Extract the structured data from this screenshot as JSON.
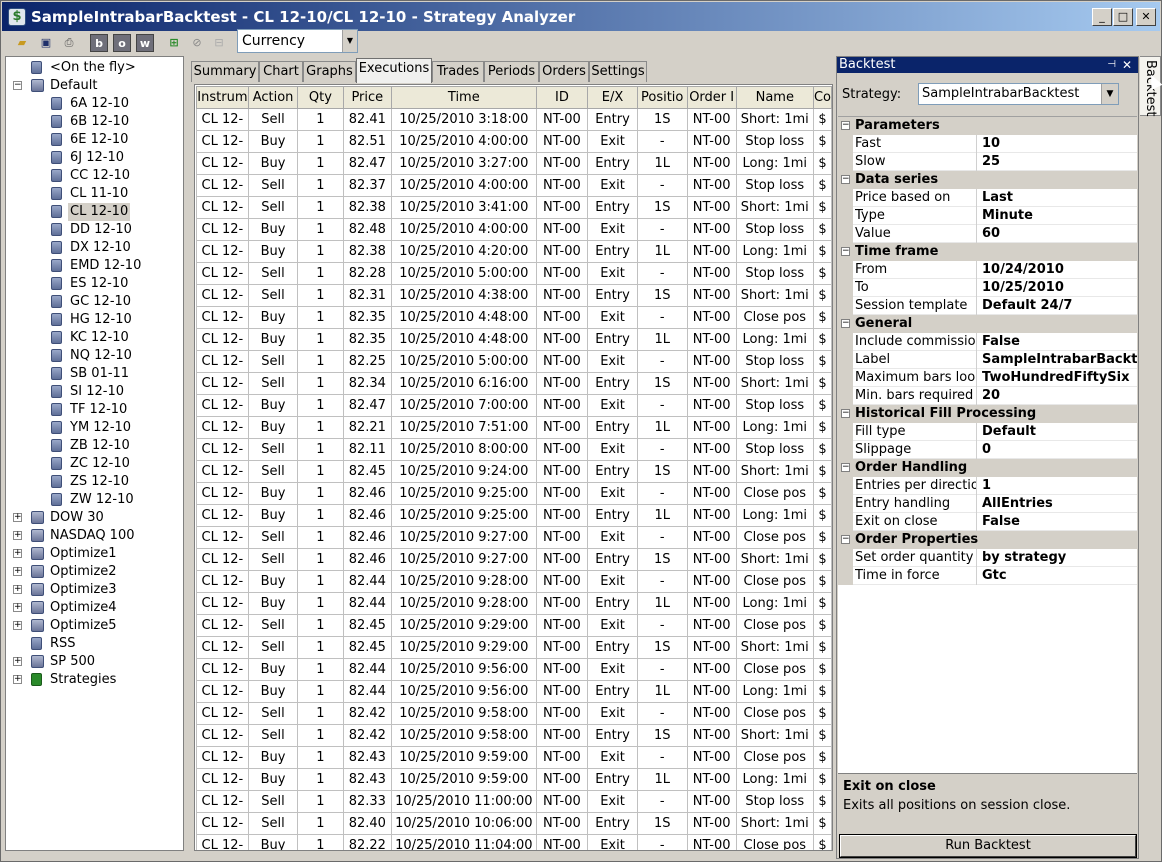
{
  "window": {
    "title": "SampleIntrabarBacktest - CL 12-10/CL 12-10 - Strategy Analyzer",
    "min": "_",
    "max": "□",
    "close": "✕"
  },
  "toolbar": {
    "currency": "Currency"
  },
  "tree": [
    {
      "label": "<On the fly>",
      "type": "item"
    },
    {
      "label": "Default",
      "type": "group",
      "expanded": true
    },
    {
      "label": "6A 12-10",
      "type": "child"
    },
    {
      "label": "6B 12-10",
      "type": "child"
    },
    {
      "label": "6E 12-10",
      "type": "child"
    },
    {
      "label": "6J 12-10",
      "type": "child"
    },
    {
      "label": "CC 12-10",
      "type": "child"
    },
    {
      "label": "CL 11-10",
      "type": "child"
    },
    {
      "label": "CL 12-10",
      "type": "child",
      "selected": true
    },
    {
      "label": "DD 12-10",
      "type": "child"
    },
    {
      "label": "DX 12-10",
      "type": "child"
    },
    {
      "label": "EMD 12-10",
      "type": "child"
    },
    {
      "label": "ES 12-10",
      "type": "child"
    },
    {
      "label": "GC 12-10",
      "type": "child"
    },
    {
      "label": "HG 12-10",
      "type": "child"
    },
    {
      "label": "KC 12-10",
      "type": "child"
    },
    {
      "label": "NQ 12-10",
      "type": "child"
    },
    {
      "label": "SB 01-11",
      "type": "child"
    },
    {
      "label": "SI 12-10",
      "type": "child"
    },
    {
      "label": "TF 12-10",
      "type": "child"
    },
    {
      "label": "YM 12-10",
      "type": "child"
    },
    {
      "label": "ZB 12-10",
      "type": "child"
    },
    {
      "label": "ZC 12-10",
      "type": "child"
    },
    {
      "label": "ZS 12-10",
      "type": "child"
    },
    {
      "label": "ZW 12-10",
      "type": "child"
    },
    {
      "label": "DOW 30",
      "type": "group",
      "expanded": false
    },
    {
      "label": "NASDAQ 100",
      "type": "group",
      "expanded": false
    },
    {
      "label": "Optimize1",
      "type": "group",
      "expanded": false
    },
    {
      "label": "Optimize2",
      "type": "group",
      "expanded": false
    },
    {
      "label": "Optimize3",
      "type": "group",
      "expanded": false
    },
    {
      "label": "Optimize4",
      "type": "group",
      "expanded": false
    },
    {
      "label": "Optimize5",
      "type": "group",
      "expanded": false
    },
    {
      "label": "RSS",
      "type": "item"
    },
    {
      "label": "SP 500",
      "type": "group",
      "expanded": false
    },
    {
      "label": "Strategies",
      "type": "strategies",
      "expanded": false
    }
  ],
  "tabs": [
    "Summary",
    "Chart",
    "Graphs",
    "Executions",
    "Trades",
    "Periods",
    "Orders",
    "Settings"
  ],
  "active_tab": "Executions",
  "table": {
    "columns": [
      "Instrum",
      "Action",
      "Qty",
      "Price",
      "Time",
      "ID",
      "E/X",
      "Positio",
      "Order I",
      "Name",
      "Co"
    ],
    "rows": [
      [
        "CL 12-",
        "Sell",
        "1",
        "82.41",
        "10/25/2010 3:18:00",
        "NT-00",
        "Entry",
        "1S",
        "NT-00",
        "Short: 1mi",
        "$"
      ],
      [
        "CL 12-",
        "Buy",
        "1",
        "82.51",
        "10/25/2010 4:00:00",
        "NT-00",
        "Exit",
        "-",
        "NT-00",
        "Stop loss",
        "$"
      ],
      [
        "CL 12-",
        "Buy",
        "1",
        "82.47",
        "10/25/2010 3:27:00",
        "NT-00",
        "Entry",
        "1L",
        "NT-00",
        "Long: 1mi",
        "$"
      ],
      [
        "CL 12-",
        "Sell",
        "1",
        "82.37",
        "10/25/2010 4:00:00",
        "NT-00",
        "Exit",
        "-",
        "NT-00",
        "Stop loss",
        "$"
      ],
      [
        "CL 12-",
        "Sell",
        "1",
        "82.38",
        "10/25/2010 3:41:00",
        "NT-00",
        "Entry",
        "1S",
        "NT-00",
        "Short: 1mi",
        "$"
      ],
      [
        "CL 12-",
        "Buy",
        "1",
        "82.48",
        "10/25/2010 4:00:00",
        "NT-00",
        "Exit",
        "-",
        "NT-00",
        "Stop loss",
        "$"
      ],
      [
        "CL 12-",
        "Buy",
        "1",
        "82.38",
        "10/25/2010 4:20:00",
        "NT-00",
        "Entry",
        "1L",
        "NT-00",
        "Long: 1mi",
        "$"
      ],
      [
        "CL 12-",
        "Sell",
        "1",
        "82.28",
        "10/25/2010 5:00:00",
        "NT-00",
        "Exit",
        "-",
        "NT-00",
        "Stop loss",
        "$"
      ],
      [
        "CL 12-",
        "Sell",
        "1",
        "82.31",
        "10/25/2010 4:38:00",
        "NT-00",
        "Entry",
        "1S",
        "NT-00",
        "Short: 1mi",
        "$"
      ],
      [
        "CL 12-",
        "Buy",
        "1",
        "82.35",
        "10/25/2010 4:48:00",
        "NT-00",
        "Exit",
        "-",
        "NT-00",
        "Close pos",
        "$"
      ],
      [
        "CL 12-",
        "Buy",
        "1",
        "82.35",
        "10/25/2010 4:48:00",
        "NT-00",
        "Entry",
        "1L",
        "NT-00",
        "Long: 1mi",
        "$"
      ],
      [
        "CL 12-",
        "Sell",
        "1",
        "82.25",
        "10/25/2010 5:00:00",
        "NT-00",
        "Exit",
        "-",
        "NT-00",
        "Stop loss",
        "$"
      ],
      [
        "CL 12-",
        "Sell",
        "1",
        "82.34",
        "10/25/2010 6:16:00",
        "NT-00",
        "Entry",
        "1S",
        "NT-00",
        "Short: 1mi",
        "$"
      ],
      [
        "CL 12-",
        "Buy",
        "1",
        "82.47",
        "10/25/2010 7:00:00",
        "NT-00",
        "Exit",
        "-",
        "NT-00",
        "Stop loss",
        "$"
      ],
      [
        "CL 12-",
        "Buy",
        "1",
        "82.21",
        "10/25/2010 7:51:00",
        "NT-00",
        "Entry",
        "1L",
        "NT-00",
        "Long: 1mi",
        "$"
      ],
      [
        "CL 12-",
        "Sell",
        "1",
        "82.11",
        "10/25/2010 8:00:00",
        "NT-00",
        "Exit",
        "-",
        "NT-00",
        "Stop loss",
        "$"
      ],
      [
        "CL 12-",
        "Sell",
        "1",
        "82.45",
        "10/25/2010 9:24:00",
        "NT-00",
        "Entry",
        "1S",
        "NT-00",
        "Short: 1mi",
        "$"
      ],
      [
        "CL 12-",
        "Buy",
        "1",
        "82.46",
        "10/25/2010 9:25:00",
        "NT-00",
        "Exit",
        "-",
        "NT-00",
        "Close pos",
        "$"
      ],
      [
        "CL 12-",
        "Buy",
        "1",
        "82.46",
        "10/25/2010 9:25:00",
        "NT-00",
        "Entry",
        "1L",
        "NT-00",
        "Long: 1mi",
        "$"
      ],
      [
        "CL 12-",
        "Sell",
        "1",
        "82.46",
        "10/25/2010 9:27:00",
        "NT-00",
        "Exit",
        "-",
        "NT-00",
        "Close pos",
        "$"
      ],
      [
        "CL 12-",
        "Sell",
        "1",
        "82.46",
        "10/25/2010 9:27:00",
        "NT-00",
        "Entry",
        "1S",
        "NT-00",
        "Short: 1mi",
        "$"
      ],
      [
        "CL 12-",
        "Buy",
        "1",
        "82.44",
        "10/25/2010 9:28:00",
        "NT-00",
        "Exit",
        "-",
        "NT-00",
        "Close pos",
        "$"
      ],
      [
        "CL 12-",
        "Buy",
        "1",
        "82.44",
        "10/25/2010 9:28:00",
        "NT-00",
        "Entry",
        "1L",
        "NT-00",
        "Long: 1mi",
        "$"
      ],
      [
        "CL 12-",
        "Sell",
        "1",
        "82.45",
        "10/25/2010 9:29:00",
        "NT-00",
        "Exit",
        "-",
        "NT-00",
        "Close pos",
        "$"
      ],
      [
        "CL 12-",
        "Sell",
        "1",
        "82.45",
        "10/25/2010 9:29:00",
        "NT-00",
        "Entry",
        "1S",
        "NT-00",
        "Short: 1mi",
        "$"
      ],
      [
        "CL 12-",
        "Buy",
        "1",
        "82.44",
        "10/25/2010 9:56:00",
        "NT-00",
        "Exit",
        "-",
        "NT-00",
        "Close pos",
        "$"
      ],
      [
        "CL 12-",
        "Buy",
        "1",
        "82.44",
        "10/25/2010 9:56:00",
        "NT-00",
        "Entry",
        "1L",
        "NT-00",
        "Long: 1mi",
        "$"
      ],
      [
        "CL 12-",
        "Sell",
        "1",
        "82.42",
        "10/25/2010 9:58:00",
        "NT-00",
        "Exit",
        "-",
        "NT-00",
        "Close pos",
        "$"
      ],
      [
        "CL 12-",
        "Sell",
        "1",
        "82.42",
        "10/25/2010 9:58:00",
        "NT-00",
        "Entry",
        "1S",
        "NT-00",
        "Short: 1mi",
        "$"
      ],
      [
        "CL 12-",
        "Buy",
        "1",
        "82.43",
        "10/25/2010 9:59:00",
        "NT-00",
        "Exit",
        "-",
        "NT-00",
        "Close pos",
        "$"
      ],
      [
        "CL 12-",
        "Buy",
        "1",
        "82.43",
        "10/25/2010 9:59:00",
        "NT-00",
        "Entry",
        "1L",
        "NT-00",
        "Long: 1mi",
        "$"
      ],
      [
        "CL 12-",
        "Sell",
        "1",
        "82.33",
        "10/25/2010 11:00:00",
        "NT-00",
        "Exit",
        "-",
        "NT-00",
        "Stop loss",
        "$"
      ],
      [
        "CL 12-",
        "Sell",
        "1",
        "82.40",
        "10/25/2010 10:06:00",
        "NT-00",
        "Entry",
        "1S",
        "NT-00",
        "Short: 1mi",
        "$"
      ],
      [
        "CL 12-",
        "Buy",
        "1",
        "82.22",
        "10/25/2010 11:04:00",
        "NT-00",
        "Exit",
        "-",
        "NT-00",
        "Close pos",
        "$"
      ]
    ]
  },
  "panel": {
    "title": "Backtest",
    "side_tab": "Backtest",
    "strategy_label": "Strategy:",
    "strategy_value": "SampleIntrabarBacktest",
    "sections": [
      {
        "title": "Parameters",
        "rows": [
          [
            "Fast",
            "10"
          ],
          [
            "Slow",
            "25"
          ]
        ]
      },
      {
        "title": "Data series",
        "rows": [
          [
            "Price based on",
            "Last"
          ],
          [
            "Type",
            "Minute"
          ],
          [
            "Value",
            "60"
          ]
        ]
      },
      {
        "title": "Time frame",
        "rows": [
          [
            "From",
            "10/24/2010"
          ],
          [
            "To",
            "10/25/2010"
          ],
          [
            "Session template",
            "Default 24/7"
          ]
        ]
      },
      {
        "title": "General",
        "rows": [
          [
            "Include commission",
            "False"
          ],
          [
            "Label",
            "SampleIntrabarBackte"
          ],
          [
            "Maximum bars look b",
            "TwoHundredFiftySix"
          ],
          [
            "Min. bars required",
            "20"
          ]
        ]
      },
      {
        "title": "Historical Fill Processing",
        "rows": [
          [
            "Fill type",
            "Default"
          ],
          [
            "Slippage",
            "0"
          ]
        ]
      },
      {
        "title": "Order Handling",
        "rows": [
          [
            "Entries per direction",
            "1"
          ],
          [
            "Entry handling",
            "AllEntries"
          ],
          [
            "Exit on close",
            "False"
          ]
        ]
      },
      {
        "title": "Order Properties",
        "rows": [
          [
            "Set order quantity",
            "by strategy"
          ],
          [
            "Time in force",
            "Gtc"
          ]
        ]
      }
    ],
    "help_title": "Exit on close",
    "help_desc": "Exits all positions on session close.",
    "run_button": "Run Backtest"
  }
}
